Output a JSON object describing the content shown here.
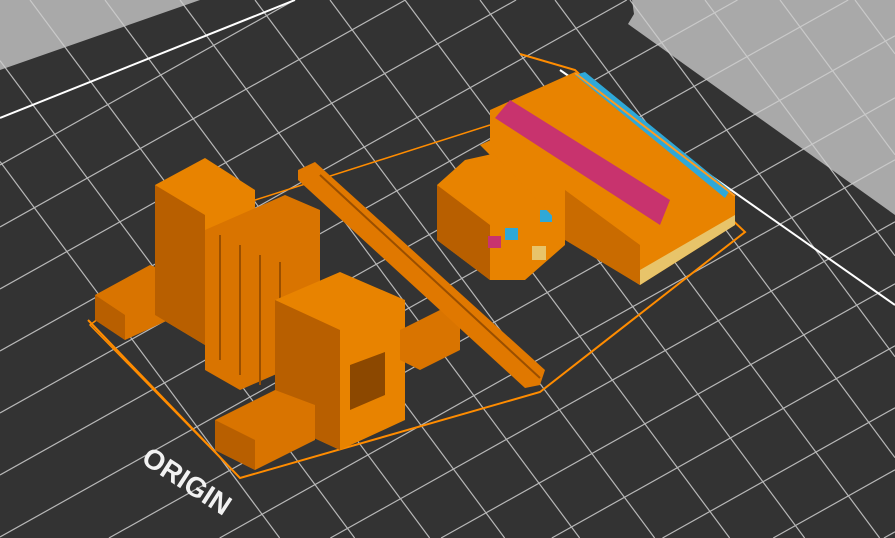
{
  "viewport": {
    "bed_label": "ORIGIN",
    "colors": {
      "background": "#a9a9a9",
      "bed": "#333333",
      "grid": "#d8d8d8",
      "perimeter": "#ff8c00",
      "model": "#e07800",
      "model_dark": "#b85f00",
      "infill": "#c8336e",
      "support": "#2fa8d8",
      "skirt": "#ff8c00",
      "bridge": "#e8c46a"
    }
  }
}
